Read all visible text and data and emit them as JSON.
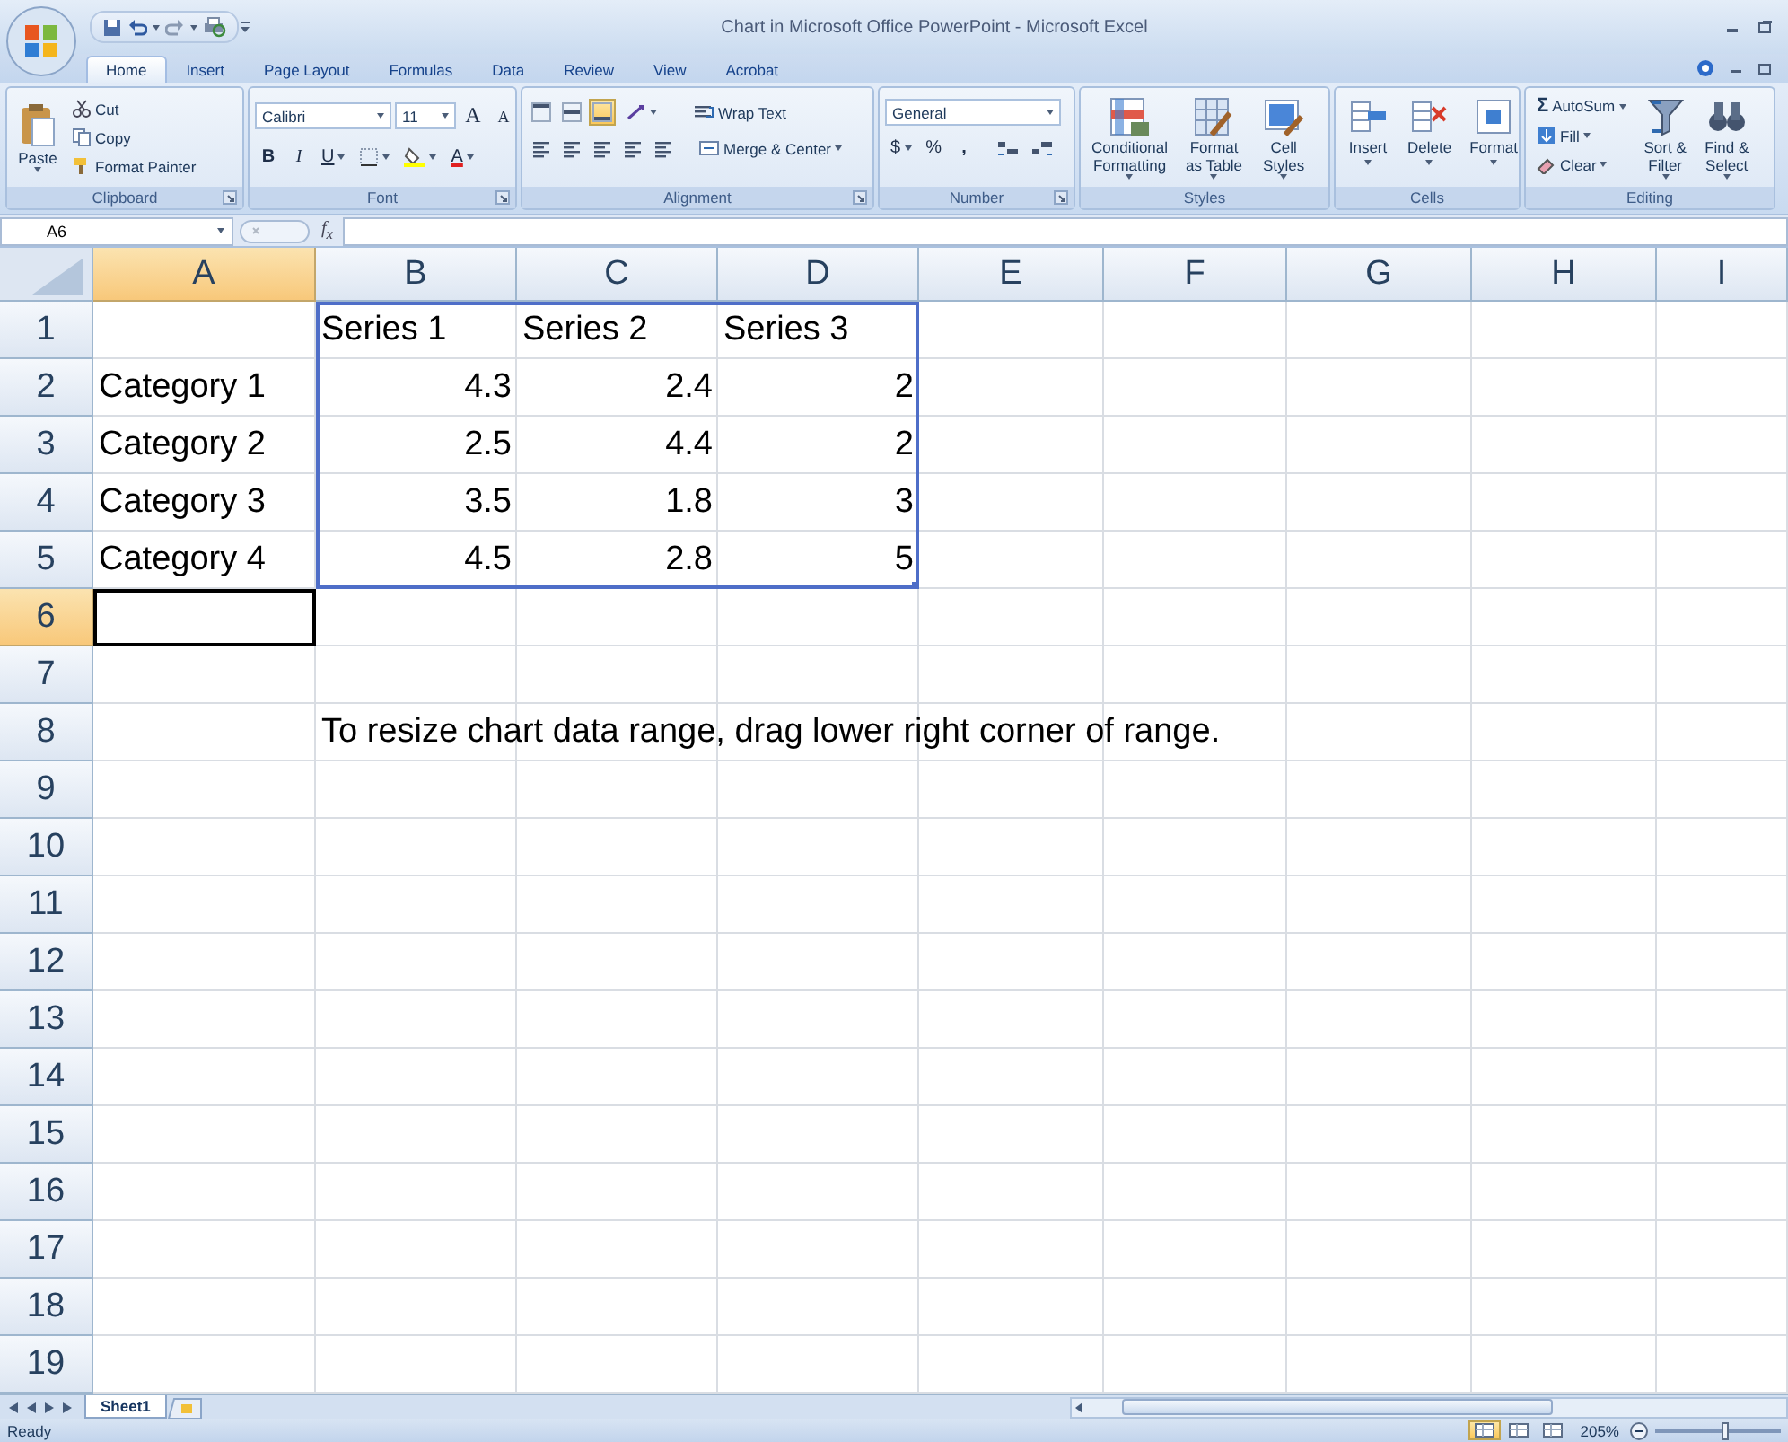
{
  "window": {
    "title": "Chart in Microsoft Office PowerPoint - Microsoft Excel"
  },
  "tabs": [
    {
      "label": "Home",
      "selected": true
    },
    {
      "label": "Insert",
      "selected": false
    },
    {
      "label": "Page Layout",
      "selected": false
    },
    {
      "label": "Formulas",
      "selected": false
    },
    {
      "label": "Data",
      "selected": false
    },
    {
      "label": "Review",
      "selected": false
    },
    {
      "label": "View",
      "selected": false
    },
    {
      "label": "Acrobat",
      "selected": false
    }
  ],
  "ribbon": {
    "groups": [
      {
        "kind": "clipboard",
        "label": "Clipboard",
        "buttons": [
          "Paste",
          "Cut",
          "Copy",
          "Format Painter"
        ]
      },
      {
        "kind": "font",
        "label": "Font",
        "font_name": "Calibri",
        "font_size": "11",
        "glyphs": [
          "A",
          "A",
          "B",
          "I",
          "U",
          "A"
        ]
      },
      {
        "kind": "alignment",
        "label": "Alignment",
        "align_buttons": [
          {
            "selected": false
          },
          {
            "selected": false
          },
          {
            "selected": true
          }
        ],
        "buttons": [
          "Wrap Text",
          "Merge & Center"
        ]
      },
      {
        "kind": "number",
        "label": "Number",
        "format": "General",
        "glyphs": [
          "$",
          "%",
          ","
        ]
      },
      {
        "kind": "styles",
        "label": "Styles",
        "buttons": [
          "Conditional\nFormatting",
          "Format\nas Table",
          "Cell\nStyles"
        ]
      },
      {
        "kind": "cells",
        "label": "Cells",
        "buttons": [
          "Insert",
          "Delete",
          "Format"
        ]
      },
      {
        "kind": "editing",
        "label": "Editing",
        "glyphs": [
          "Σ"
        ],
        "buttons": [
          "AutoSum",
          "Fill",
          "Clear",
          "Sort &\nFilter",
          "Find &\nSelect"
        ]
      }
    ]
  },
  "formula_bar": {
    "name_box": "A6",
    "function_label": "f$_{x}$"
  },
  "sheet": {
    "columns": [
      {
        "label": "A",
        "selected": true
      },
      {
        "label": "B",
        "selected": false
      },
      {
        "label": "C",
        "selected": false
      },
      {
        "label": "D",
        "selected": false
      },
      {
        "label": "E",
        "selected": false
      },
      {
        "label": "F",
        "selected": false
      },
      {
        "label": "G",
        "selected": false
      },
      {
        "label": "H",
        "selected": false
      },
      {
        "label": "I",
        "selected": false
      }
    ],
    "rows": [
      {
        "label": "1",
        "selected": false,
        "cells": [
          null,
          {
            "text": "Series 1",
            "kind": "text",
            "in_data_range": true
          },
          {
            "text": "Series 2",
            "kind": "text",
            "in_data_range": true
          },
          {
            "text": "Series 3",
            "kind": "text",
            "in_data_range": true
          }
        ]
      },
      {
        "label": "2",
        "selected": false,
        "cells": [
          {
            "text": "Category 1",
            "kind": "text",
            "in_data_range": false
          },
          {
            "text": "4.3",
            "kind": "number",
            "in_data_range": true
          },
          {
            "text": "2.4",
            "kind": "number",
            "in_data_range": true
          },
          {
            "text": "2",
            "kind": "number",
            "in_data_range": true
          }
        ]
      },
      {
        "label": "3",
        "selected": false,
        "cells": [
          {
            "text": "Category 2",
            "kind": "text",
            "in_data_range": false
          },
          {
            "text": "2.5",
            "kind": "number",
            "in_data_range": true
          },
          {
            "text": "4.4",
            "kind": "number",
            "in_data_range": true
          },
          {
            "text": "2",
            "kind": "number",
            "in_data_range": true
          }
        ]
      },
      {
        "label": "4",
        "selected": false,
        "cells": [
          {
            "text": "Category 3",
            "kind": "text",
            "in_data_range": false
          },
          {
            "text": "3.5",
            "kind": "number",
            "in_data_range": true
          },
          {
            "text": "1.8",
            "kind": "number",
            "in_data_range": true
          },
          {
            "text": "3",
            "kind": "number",
            "in_data_range": true
          }
        ]
      },
      {
        "label": "5",
        "selected": false,
        "cells": [
          {
            "text": "Category 4",
            "kind": "text",
            "in_data_range": false
          },
          {
            "text": "4.5",
            "kind": "number",
            "in_data_range": true
          },
          {
            "text": "2.8",
            "kind": "number",
            "in_data_range": true
          },
          {
            "text": "5",
            "kind": "number",
            "in_data_range": true
          }
        ]
      },
      {
        "label": "6",
        "selected": true
      },
      {
        "label": "7",
        "selected": false
      },
      {
        "label": "8",
        "selected": false,
        "cells": [
          null,
          {
            "text": "To resize chart data range, drag lower right corner of range.",
            "kind": "text",
            "in_data_range": false
          }
        ]
      },
      {
        "label": "9",
        "selected": false
      },
      {
        "label": "10",
        "selected": false
      },
      {
        "label": "11",
        "selected": false
      },
      {
        "label": "12",
        "selected": false
      },
      {
        "label": "13",
        "selected": false
      },
      {
        "label": "14",
        "selected": false
      },
      {
        "label": "15",
        "selected": false
      },
      {
        "label": "16",
        "selected": false
      },
      {
        "label": "17",
        "selected": false
      },
      {
        "label": "18",
        "selected": false
      },
      {
        "label": "19",
        "selected": false
      }
    ]
  },
  "sheet_tabs": [
    {
      "label": "Sheet1",
      "selected": true
    }
  ],
  "status_bar": {
    "status": "Ready",
    "views": [
      {
        "selected": true
      },
      {
        "selected": false
      },
      {
        "selected": false
      }
    ],
    "zoom": "205%",
    "zoom_slider": {
      "level": 0.55
    }
  }
}
